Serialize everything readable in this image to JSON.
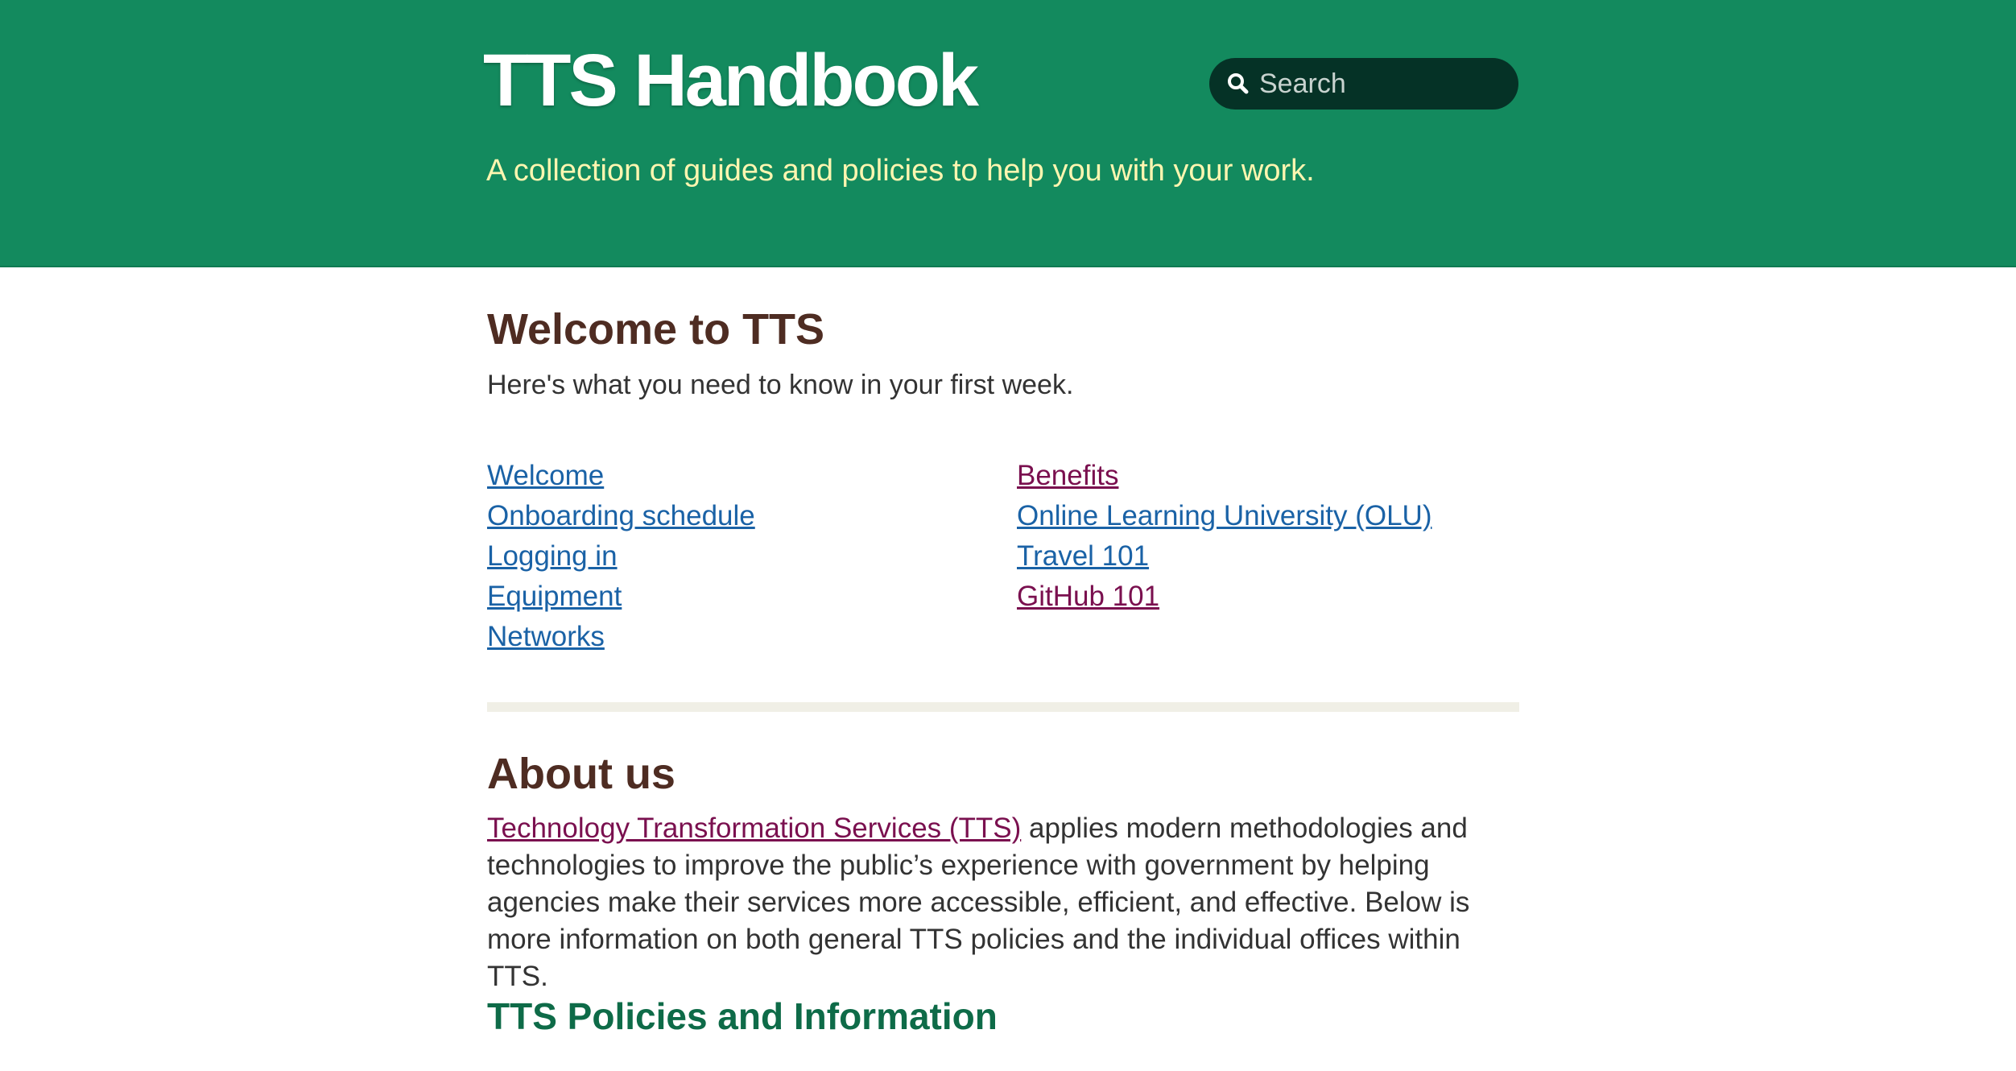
{
  "header": {
    "title": "TTS Handbook",
    "tagline": "A collection of guides and policies to help you with your work.",
    "search": {
      "placeholder": "Search",
      "icon": "search-icon"
    },
    "colors": {
      "background": "#138a5e",
      "tagline": "#fff6b0",
      "search_background": "#053226"
    }
  },
  "welcome": {
    "title": "Welcome to TTS",
    "subtitle": "Here's what you need to know in your first week.",
    "links_left": [
      {
        "label": "Welcome",
        "visited": false
      },
      {
        "label": "Onboarding schedule",
        "visited": false
      },
      {
        "label": "Logging in",
        "visited": false
      },
      {
        "label": "Equipment",
        "visited": false
      },
      {
        "label": "Networks",
        "visited": false
      }
    ],
    "links_right": [
      {
        "label": "Benefits",
        "visited": true
      },
      {
        "label": "Online Learning University (OLU)",
        "visited": false
      },
      {
        "label": "Travel 101",
        "visited": false
      },
      {
        "label": "GitHub 101",
        "visited": true
      }
    ]
  },
  "about": {
    "title": "About us",
    "link_text": "Technology Transformation Services (TTS)",
    "body": " applies modern methodologies and technologies to improve the public’s experience with government by helping agencies make their services more accessible, efficient, and effective. Below is more information on both general TTS policies and the individual offices within TTS."
  },
  "policies": {
    "title": "TTS Policies and Information"
  },
  "colors": {
    "heading": "#4e2c22",
    "link": "#1a62a6",
    "link_visited": "#7a104f",
    "subheading": "#0e6b48",
    "divider": "#f0efe6"
  }
}
